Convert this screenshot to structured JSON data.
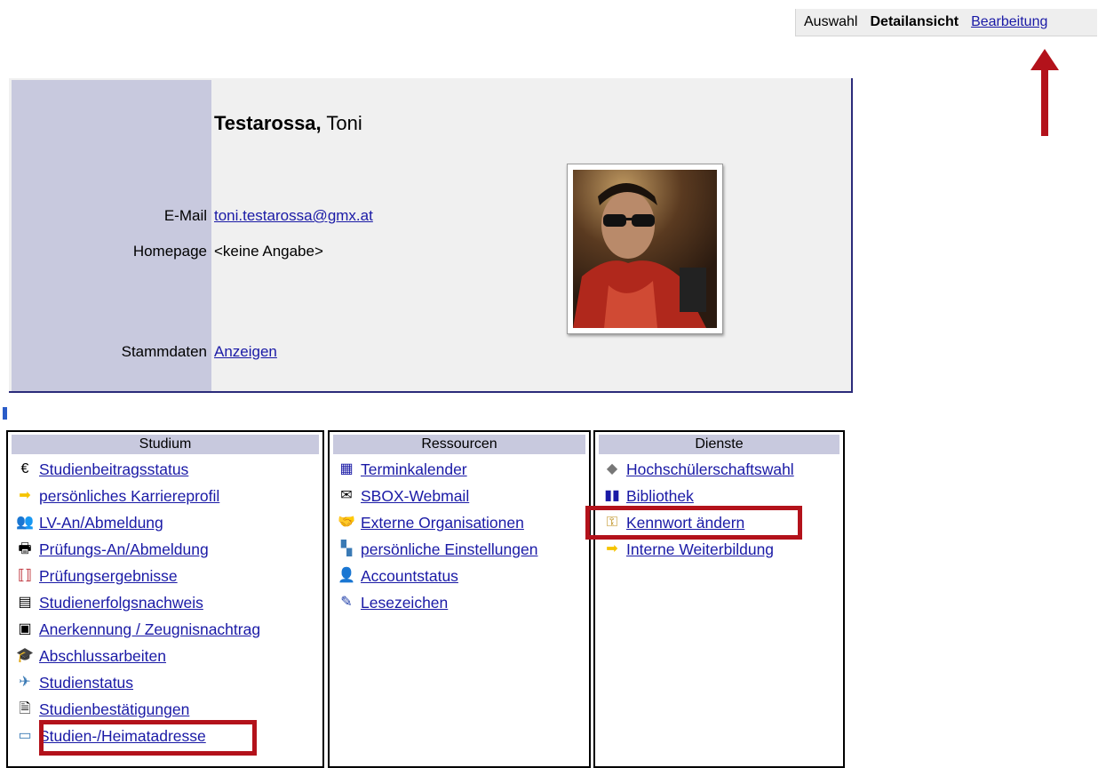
{
  "topnav": {
    "item1": "Auswahl",
    "item2": "Detailansicht",
    "item3": "Bearbeitung"
  },
  "profile": {
    "last_name": "Testarossa,",
    "first_name": "Toni",
    "email_label": "E-Mail",
    "email_value": "toni.testarossa@gmx.at",
    "homepage_label": "Homepage",
    "homepage_value": "<keine Angabe>",
    "stammdaten_label": "Stammdaten",
    "stammdaten_link": "Anzeigen"
  },
  "studium": {
    "title": "Studium",
    "items": [
      {
        "label": "Studienbeitragsstatus",
        "icon": "euro-icon"
      },
      {
        "label": "persönliches Karriereprofil",
        "icon": "arrow-icon"
      },
      {
        "label": "LV-An/Abmeldung",
        "icon": "people-icon"
      },
      {
        "label": "Prüfungs-An/Abmeldung",
        "icon": "exam-icon"
      },
      {
        "label": "Prüfungsergebnisse",
        "icon": "results-icon"
      },
      {
        "label": "Studienerfolgsnachweis",
        "icon": "document-icon"
      },
      {
        "label": "Anerkennung / Zeugnisnachtrag",
        "icon": "certificate-icon"
      },
      {
        "label": "Abschlussarbeiten",
        "icon": "graduation-cap-icon"
      },
      {
        "label": "Studienstatus",
        "icon": "status-icon"
      },
      {
        "label": "Studienbestätigungen",
        "icon": "confirmation-icon"
      },
      {
        "label": "Studien-/Heimatadresse",
        "icon": "address-card-icon"
      }
    ]
  },
  "ressourcen": {
    "title": "Ressourcen",
    "items": [
      {
        "label": "Terminkalender",
        "icon": "calendar-icon"
      },
      {
        "label": "SBOX-Webmail",
        "icon": "mail-icon"
      },
      {
        "label": "Externe Organisationen",
        "icon": "handshake-icon"
      },
      {
        "label": "persönliche Einstellungen",
        "icon": "settings-icon"
      },
      {
        "label": "Accountstatus",
        "icon": "account-icon"
      },
      {
        "label": "Lesezeichen",
        "icon": "bookmark-icon"
      }
    ]
  },
  "dienste": {
    "title": "Dienste",
    "items": [
      {
        "label": "Hochschülerschaftswahl",
        "icon": "ballot-icon"
      },
      {
        "label": "Bibliothek",
        "icon": "library-icon"
      },
      {
        "label": "Kennwort ändern",
        "icon": "key-icon"
      },
      {
        "label": "Interne Weiterbildung",
        "icon": "arrow-icon"
      }
    ]
  },
  "colors": {
    "accent": "#1a1aa6",
    "panel": "#c8c9de",
    "highlight": "#b3121b"
  }
}
